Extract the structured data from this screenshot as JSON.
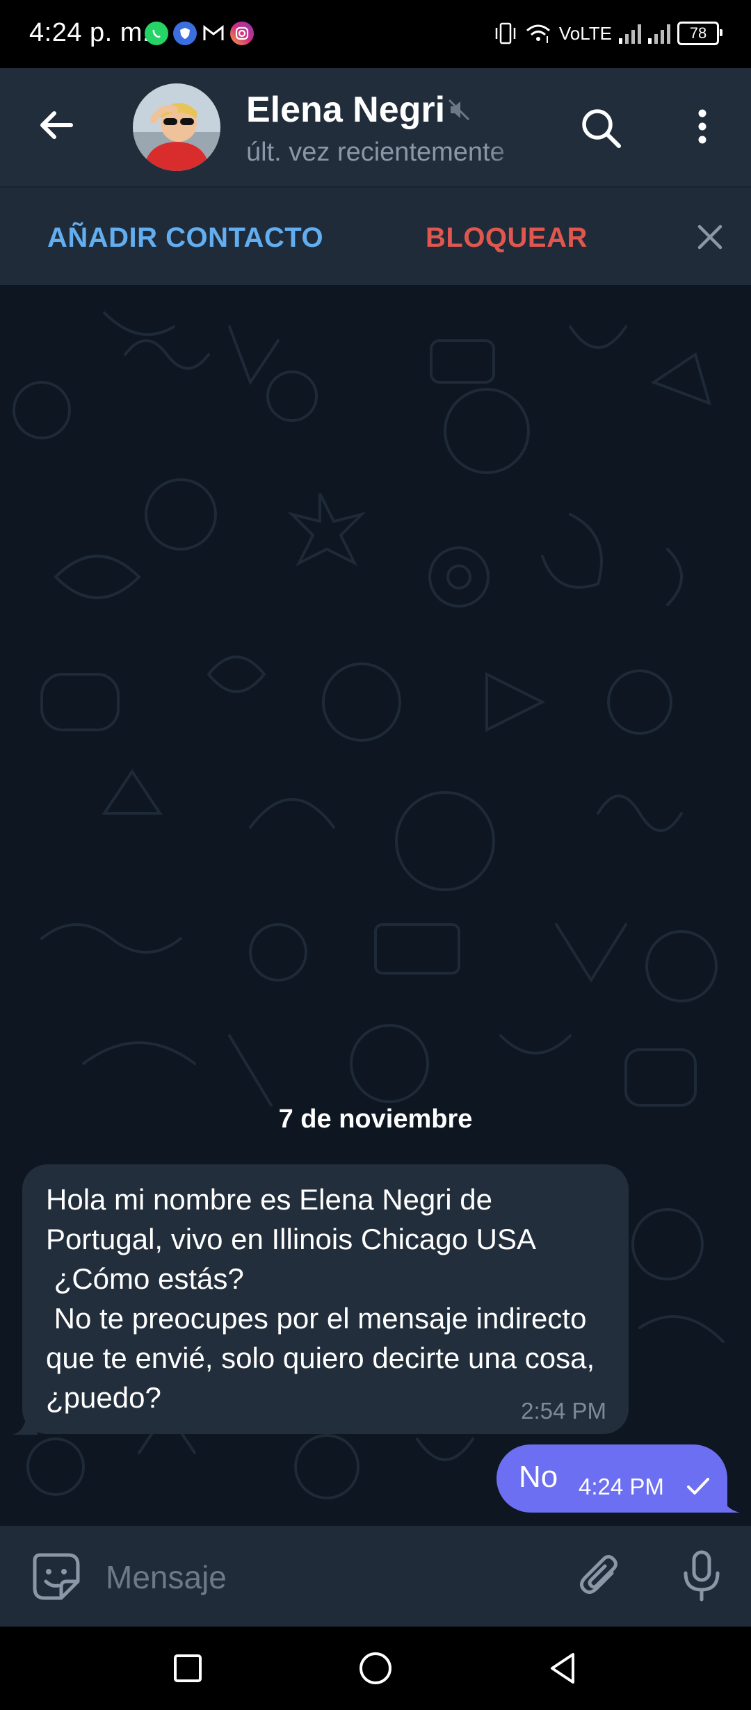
{
  "status_bar": {
    "time": "4:24 p. m.",
    "notification_icons": [
      "whatsapp-icon",
      "shield-app-icon",
      "gmail-icon",
      "instagram-icon"
    ],
    "network": "VoLTE",
    "battery": "78"
  },
  "header": {
    "contact_name": "Elena Negri",
    "contact_status": "últ. vez recientemente",
    "muted": true
  },
  "action_bar": {
    "add_contact_label": "AÑADIR CONTACTO",
    "block_label": "BLOQUEAR"
  },
  "chat": {
    "date_separator": "7 de noviembre",
    "messages": [
      {
        "direction": "incoming",
        "text": "Hola mi nombre es Elena Negri de Portugal, vivo en Illinois Chicago USA\n ¿Cómo estás?\n No te preocupes por el mensaje indirecto que te envié, solo quiero decirte una cosa, ¿puedo?",
        "time": "2:54 PM"
      },
      {
        "direction": "outgoing",
        "text": "No",
        "time": "4:24 PM",
        "status": "sent"
      }
    ]
  },
  "composer": {
    "placeholder": "Mensaje"
  },
  "colors": {
    "header_bg": "#212d3b",
    "chat_bg": "#0e1621",
    "incoming_bubble": "#222e3b",
    "outgoing_bubble": "#6c6ff1",
    "accent_blue": "#62aef0",
    "danger_red": "#e0574f"
  }
}
